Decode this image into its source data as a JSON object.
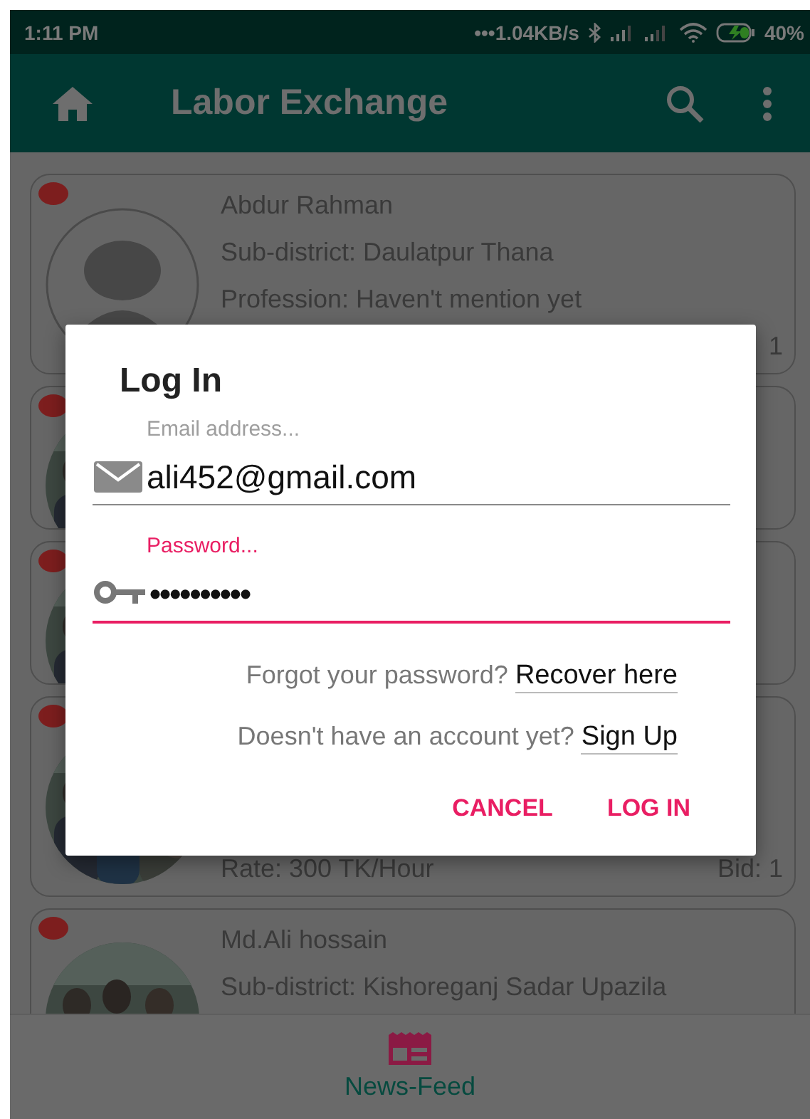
{
  "status_bar": {
    "time": "1:11 PM",
    "network_speed": "•••1.04KB/s",
    "battery": "40%"
  },
  "app_bar": {
    "title": "Labor Exchange"
  },
  "cards": [
    {
      "kind": "full",
      "avatar": {
        "kind": "default"
      },
      "name": "Abdur Rahman",
      "subdistrict": "Sub-district: Daulatpur Thana",
      "profession": "Profession: Haven't mention yet",
      "bid": "1"
    },
    {
      "kind": "compact"
    },
    {
      "kind": "compact"
    },
    {
      "kind": "full",
      "rate": "Rate: 300 TK/Hour",
      "bid": "Bid: 1"
    },
    {
      "kind": "full",
      "name": "Md.Ali hossain",
      "subdistrict": "Sub-district: Kishoreganj Sadar Upazila"
    }
  ],
  "dialog": {
    "title": "Log In",
    "fields": [
      {
        "kind": "email",
        "label": "Email address...",
        "value": "ali452@gmail.com",
        "focused": false
      },
      {
        "kind": "password",
        "label": "Password...",
        "value": "••••••••••",
        "focused": true
      }
    ],
    "links": [
      {
        "text": "Forgot your password?",
        "link": "Recover here"
      },
      {
        "text": "Doesn't have an account yet?",
        "link": "Sign Up"
      }
    ],
    "buttons": [
      "CANCEL",
      "LOG IN"
    ]
  },
  "bottom_nav": {
    "items": [
      {
        "label": "News-Feed",
        "selected": true
      }
    ]
  }
}
